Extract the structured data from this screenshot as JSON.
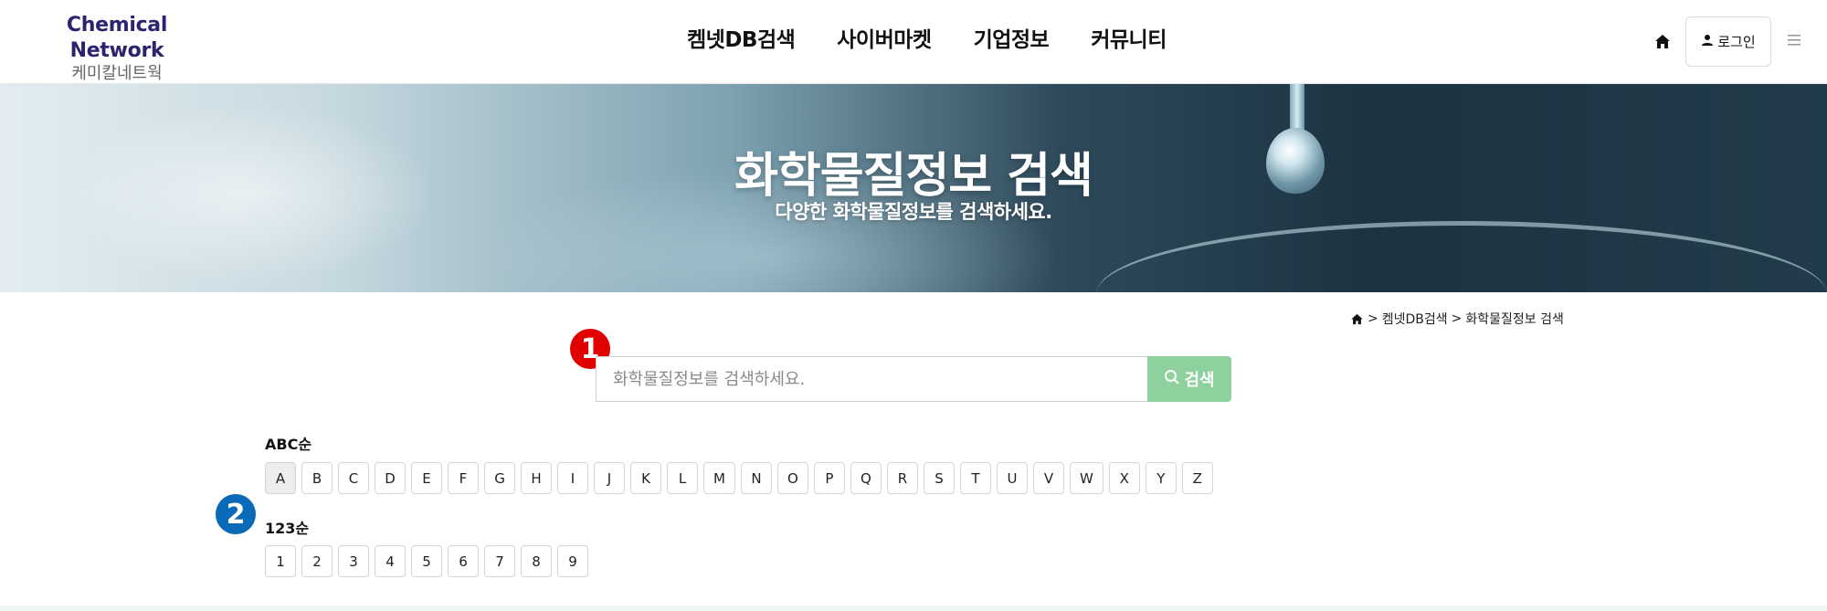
{
  "header": {
    "logo_en": "Chemical Network",
    "logo_ko": "케미칼네트웍",
    "nav": [
      {
        "label": "켐넷DB검색"
      },
      {
        "label": "사이버마켓"
      },
      {
        "label": "기업정보"
      },
      {
        "label": "커뮤니티"
      }
    ],
    "login_label": "로그인",
    "home_icon": "home-icon",
    "menu_icon": "hamburger-icon"
  },
  "hero": {
    "title": "화학물질정보 검색",
    "subtitle": "다양한 화학물질정보를 검색하세요."
  },
  "breadcrumb": {
    "items": [
      "켐넷DB검색",
      "화학물질정보 검색"
    ],
    "separator": ">"
  },
  "search": {
    "placeholder": "화학물질정보를 검색하세요.",
    "value": "",
    "button_label": "검색",
    "button_color": "#8fd19e"
  },
  "markers": {
    "one": "1",
    "two": "2",
    "one_color": "#e00000",
    "two_color": "#0a6ab8"
  },
  "index": {
    "abc_label": "ABC순",
    "abc_keys": [
      "A",
      "B",
      "C",
      "D",
      "E",
      "F",
      "G",
      "H",
      "I",
      "J",
      "K",
      "L",
      "M",
      "N",
      "O",
      "P",
      "Q",
      "R",
      "S",
      "T",
      "U",
      "V",
      "W",
      "X",
      "Y",
      "Z"
    ],
    "abc_selected": "A",
    "num_label": "123순",
    "num_keys": [
      "1",
      "2",
      "3",
      "4",
      "5",
      "6",
      "7",
      "8",
      "9"
    ]
  },
  "colors": {
    "logo": "#2b2370",
    "accent": "#8fd19e"
  }
}
